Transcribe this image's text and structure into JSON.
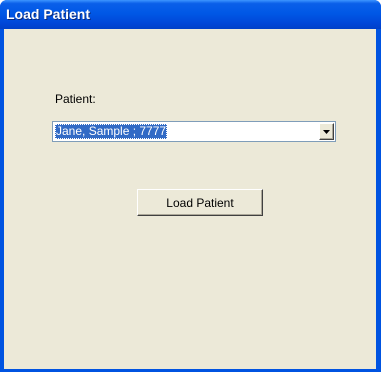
{
  "window": {
    "title": "Load Patient"
  },
  "form": {
    "patient_label": "Patient:",
    "patient_select": {
      "selected_value": "Jane, Sample ; 7777"
    },
    "load_button_label": "Load Patient"
  },
  "icons": {
    "dropdown": "chevron-down-icon"
  },
  "colors": {
    "titlebar": "#0058e6",
    "client_background": "#ece9d8",
    "selection_highlight": "#316ac5"
  }
}
